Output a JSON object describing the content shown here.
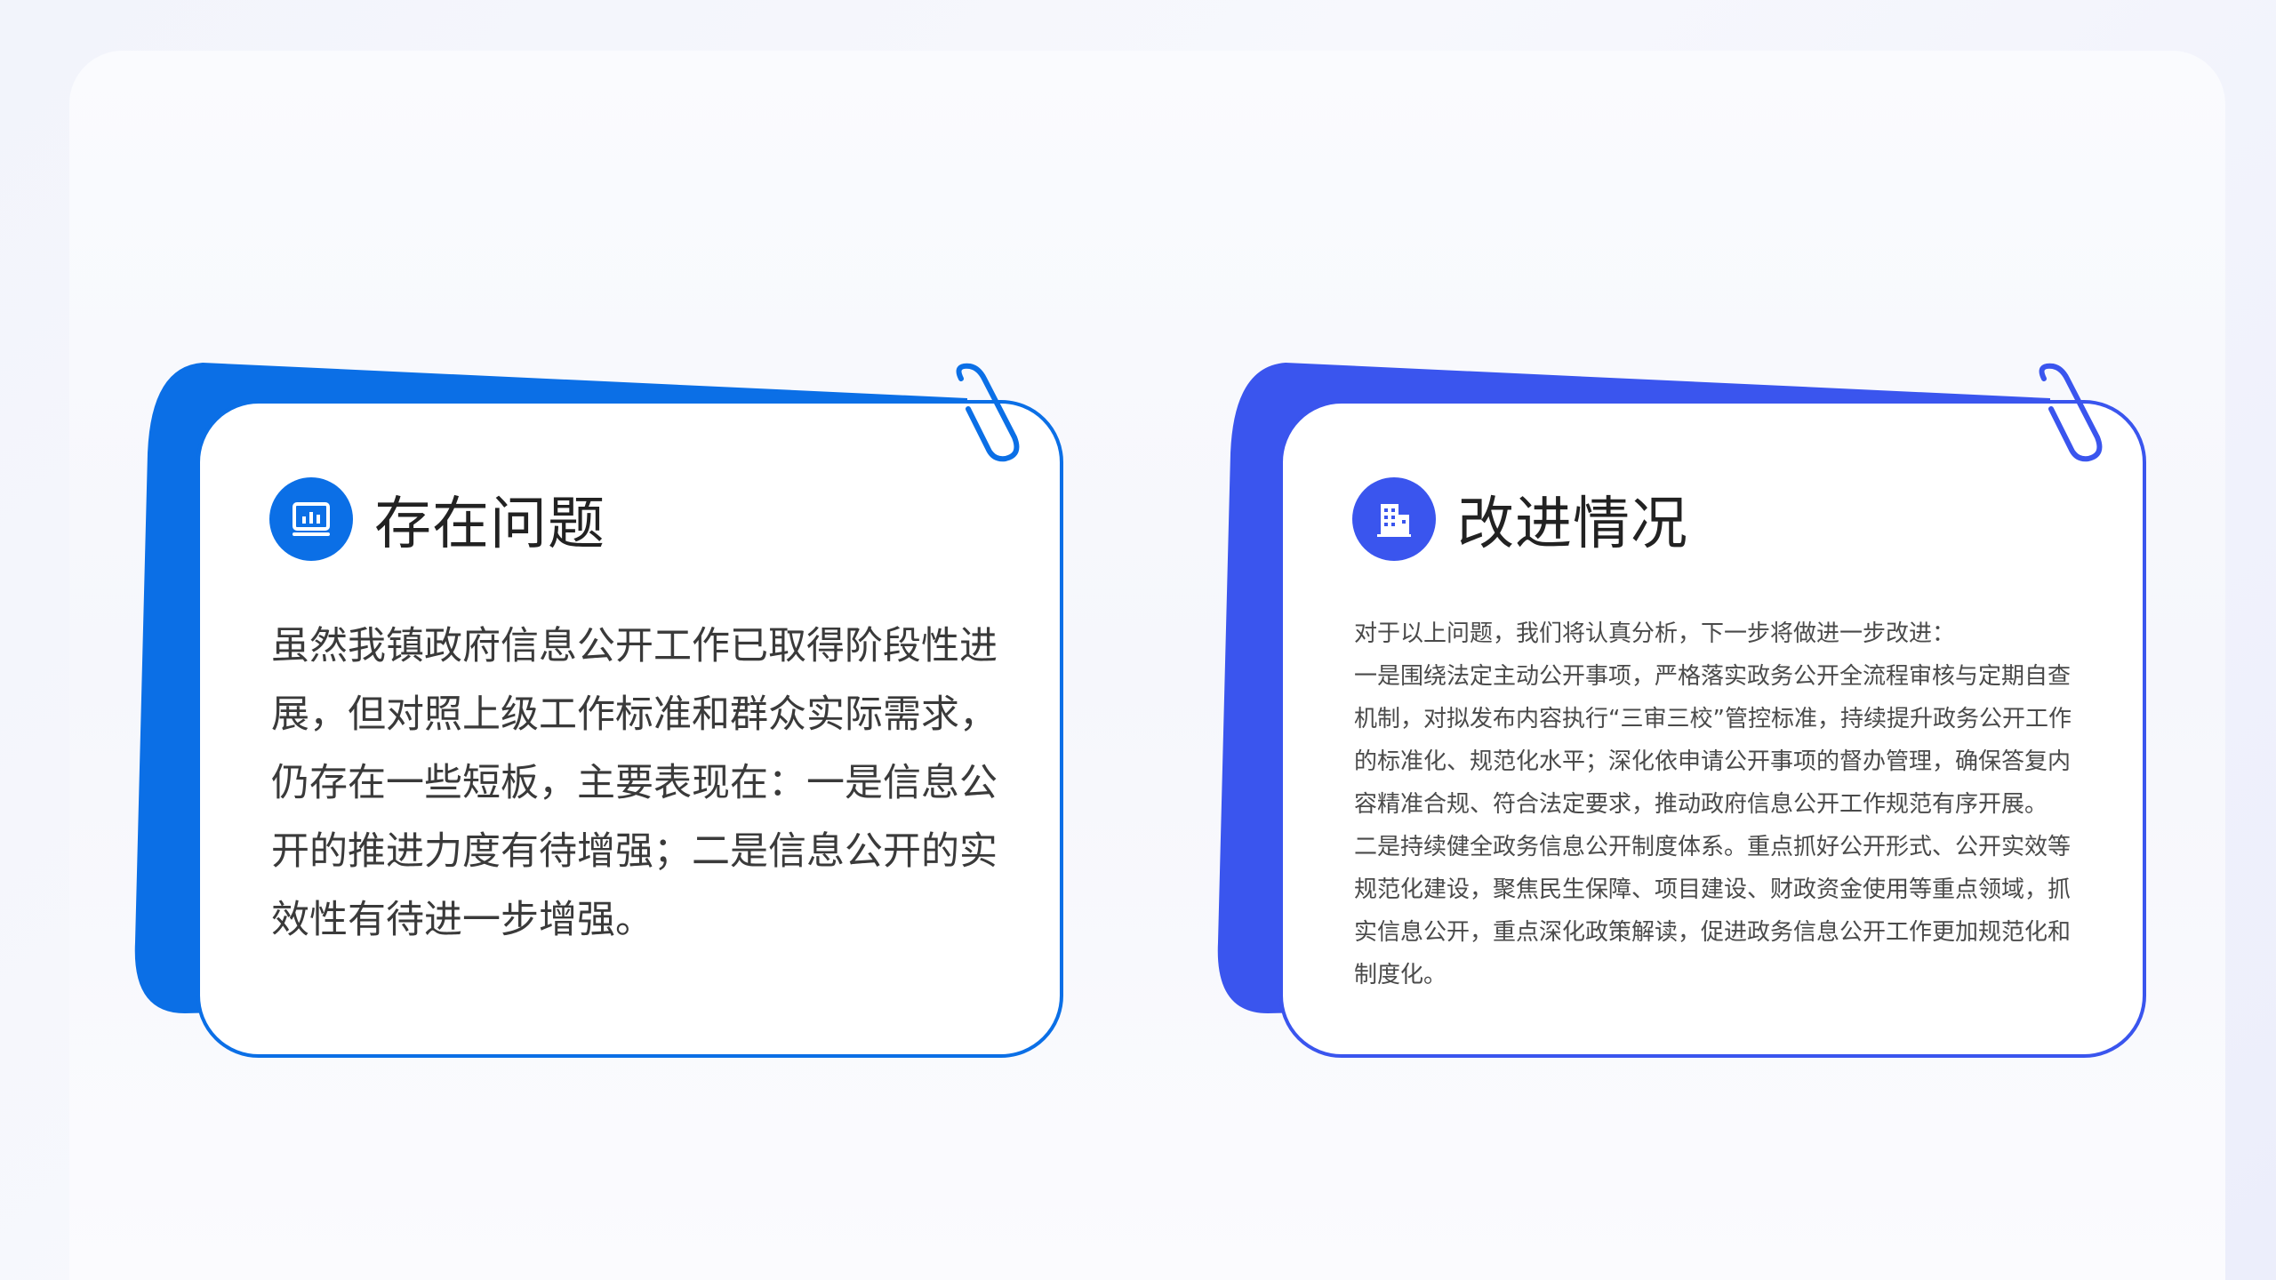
{
  "left_card": {
    "title": "存在问题",
    "icon": "chart-screen-icon",
    "body": "虽然我镇政府信息公开工作已取得阶段性进展，但对照上级工作标准和群众实际需求，仍存在一些短板，主要表现在：一是信息公开的推进力度有待增强；二是信息公开的实效性有待进一步增强。",
    "accent": "#0b6fe6"
  },
  "right_card": {
    "title": "改进情况",
    "icon": "building-icon",
    "paragraphs": [
      "对于以上问题，我们将认真分析，下一步将做进一步改进：",
      "一是围绕法定主动公开事项，严格落实政务公开全流程审核与定期自查机制，对拟发布内容执行“三审三校”管控标准，持续提升政务公开工作的标准化、规范化水平；深化依申请公开事项的督办管理，确保答复内容精准合规、符合法定要求，推动政府信息公开工作规范有序开展。",
      "二是持续健全政务信息公开制度体系。重点抓好公开形式、公开实效等规范化建设，聚焦民生保障、项目建设、财政资金使用等重点领域，抓实信息公开，重点深化政策解读，促进政务信息公开工作更加规范化和制度化。"
    ],
    "accent": "#3a55ee"
  }
}
